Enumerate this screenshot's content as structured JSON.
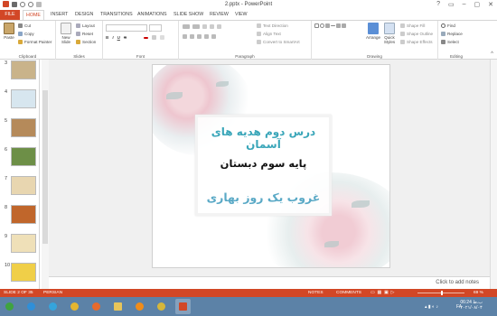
{
  "window": {
    "title": "2.pptx - PowerPoint",
    "controls": [
      "?",
      "▭",
      "–",
      "▢",
      "✕"
    ]
  },
  "tabs": [
    {
      "label": "FILE"
    },
    {
      "label": "HOME"
    },
    {
      "label": "INSERT"
    },
    {
      "label": "DESIGN"
    },
    {
      "label": "TRANSITIONS"
    },
    {
      "label": "ANIMATIONS"
    },
    {
      "label": "SLIDE SHOW"
    },
    {
      "label": "REVIEW"
    },
    {
      "label": "VIEW"
    }
  ],
  "ribbon": {
    "clipboard": {
      "paste": "Paste",
      "cut": "Cut",
      "copy": "Copy",
      "format_painter": "Format Painter",
      "label": "Clipboard"
    },
    "slides": {
      "new_slide": "New Slide",
      "layout": "Layout",
      "reset": "Reset",
      "section": "Section",
      "label": "Slides"
    },
    "font": {
      "label": "Font"
    },
    "paragraph": {
      "text_direction": "Text Direction",
      "align_text": "Align Text",
      "convert_smartart": "Convert to SmartArt",
      "label": "Paragraph"
    },
    "drawing": {
      "arrange": "Arrange",
      "quick_styles": "Quick Styles",
      "shape_fill": "Shape Fill",
      "shape_outline": "Shape Outline",
      "shape_effects": "Shape Effects",
      "label": "Drawing"
    },
    "editing": {
      "find": "Find",
      "replace": "Replace",
      "select": "Select",
      "label": "Editing"
    }
  },
  "thumbnails": [
    {
      "num": "3",
      "color": "#c9b38a"
    },
    {
      "num": "4",
      "color": "#d7e6ef"
    },
    {
      "num": "5",
      "color": "#b58a5a"
    },
    {
      "num": "6",
      "color": "#6d8f47"
    },
    {
      "num": "7",
      "color": "#e8d6b0"
    },
    {
      "num": "8",
      "color": "#c0662b"
    },
    {
      "num": "9",
      "color": "#efe0b8"
    },
    {
      "num": "10",
      "color": "#f0cf48"
    }
  ],
  "slide": {
    "line1": "درس دوم هدیه های آسمان",
    "line2": "پایه سوم دبستان",
    "line3": "غروب یک روز بهاری"
  },
  "notes_placeholder": "Click to add notes",
  "status": {
    "slide": "SLIDE 2 OF 35",
    "language": "PERSIAN",
    "notes": "NOTES",
    "comments": "COMMENTS",
    "zoom": "69 %"
  },
  "taskbar": {
    "time": "06:24 ب.ظ",
    "date": "۲۰۲۱/۰۸/۰۴",
    "lang": "FA"
  },
  "colors": {
    "accent": "#d24726",
    "taskbar": "#5c82a7",
    "title_blue": "#3aa6b9"
  }
}
